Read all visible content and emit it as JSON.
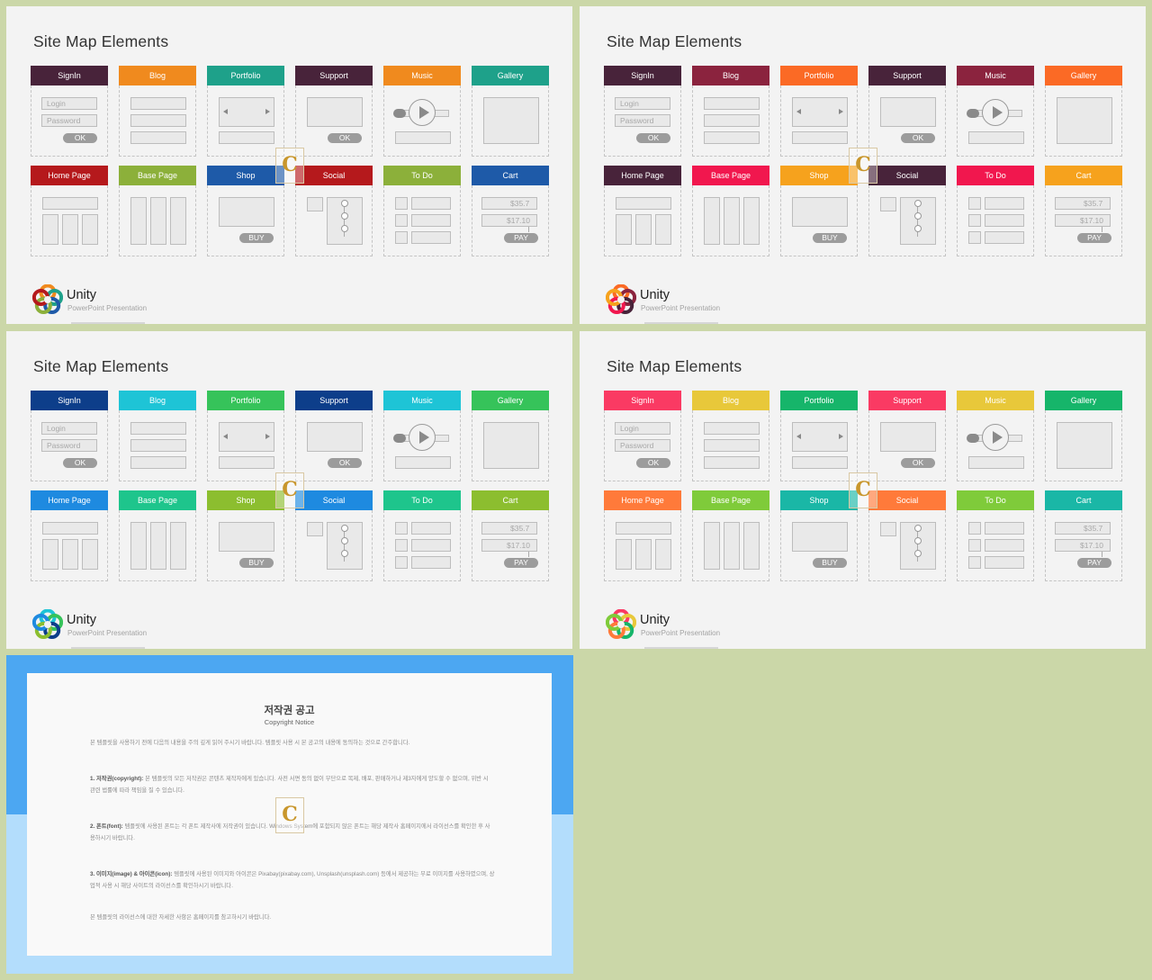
{
  "slides": [
    {
      "title": "Site Map Elements",
      "logo_title": "Unity",
      "logo_sub": "PowerPoint Presentation",
      "logo_colors": [
        "#f08a1e",
        "#1ea18a",
        "#1e5aa8",
        "#8cb03a",
        "#b5191c"
      ],
      "tiles": [
        {
          "label": "SignIn",
          "color": "#48233a",
          "kind": "signin"
        },
        {
          "label": "Blog",
          "color": "#f08a1e",
          "kind": "blog"
        },
        {
          "label": "Portfolio",
          "color": "#1ea18a",
          "kind": "portfolio"
        },
        {
          "label": "Support",
          "color": "#48233a",
          "kind": "support"
        },
        {
          "label": "Music",
          "color": "#f08a1e",
          "kind": "music"
        },
        {
          "label": "Gallery",
          "color": "#1ea18a",
          "kind": "gallery"
        },
        {
          "label": "Home Page",
          "color": "#b5191c",
          "kind": "home"
        },
        {
          "label": "Base Page",
          "color": "#8cb03a",
          "kind": "base"
        },
        {
          "label": "Shop",
          "color": "#1e5aa8",
          "kind": "shop"
        },
        {
          "label": "Social",
          "color": "#b5191c",
          "kind": "social"
        },
        {
          "label": "To Do",
          "color": "#8cb03a",
          "kind": "todo"
        },
        {
          "label": "Cart",
          "color": "#1e5aa8",
          "kind": "cart"
        }
      ]
    },
    {
      "title": "Site Map Elements",
      "logo_title": "Unity",
      "logo_sub": "PowerPoint Presentation",
      "logo_colors": [
        "#fb6a25",
        "#8b233e",
        "#48233a",
        "#f1174e",
        "#f6a21d"
      ],
      "tiles": [
        {
          "label": "SignIn",
          "color": "#48233a",
          "kind": "signin"
        },
        {
          "label": "Blog",
          "color": "#8b233e",
          "kind": "blog"
        },
        {
          "label": "Portfolio",
          "color": "#fb6a25",
          "kind": "portfolio"
        },
        {
          "label": "Support",
          "color": "#48233a",
          "kind": "support"
        },
        {
          "label": "Music",
          "color": "#8b233e",
          "kind": "music"
        },
        {
          "label": "Gallery",
          "color": "#fb6a25",
          "kind": "gallery"
        },
        {
          "label": "Home Page",
          "color": "#48233a",
          "kind": "home"
        },
        {
          "label": "Base Page",
          "color": "#f1174e",
          "kind": "base"
        },
        {
          "label": "Shop",
          "color": "#f6a21d",
          "kind": "shop"
        },
        {
          "label": "Social",
          "color": "#48233a",
          "kind": "social"
        },
        {
          "label": "To Do",
          "color": "#f1174e",
          "kind": "todo"
        },
        {
          "label": "Cart",
          "color": "#f6a21d",
          "kind": "cart"
        }
      ]
    },
    {
      "title": "Site Map Elements",
      "logo_title": "Unity",
      "logo_sub": "PowerPoint Presentation",
      "logo_colors": [
        "#1ec4d6",
        "#36c35a",
        "#0d3e8a",
        "#8cbe2f",
        "#1e8ae0"
      ],
      "tiles": [
        {
          "label": "SignIn",
          "color": "#0d3e8a",
          "kind": "signin"
        },
        {
          "label": "Blog",
          "color": "#1ec4d6",
          "kind": "blog"
        },
        {
          "label": "Portfolio",
          "color": "#36c35a",
          "kind": "portfolio"
        },
        {
          "label": "Support",
          "color": "#0d3e8a",
          "kind": "support"
        },
        {
          "label": "Music",
          "color": "#1ec4d6",
          "kind": "music"
        },
        {
          "label": "Gallery",
          "color": "#36c35a",
          "kind": "gallery"
        },
        {
          "label": "Home Page",
          "color": "#1e8ae0",
          "kind": "home"
        },
        {
          "label": "Base Page",
          "color": "#1ec58c",
          "kind": "base"
        },
        {
          "label": "Shop",
          "color": "#8cbe2f",
          "kind": "shop"
        },
        {
          "label": "Social",
          "color": "#1e8ae0",
          "kind": "social"
        },
        {
          "label": "To Do",
          "color": "#1ec58c",
          "kind": "todo"
        },
        {
          "label": "Cart",
          "color": "#8cbe2f",
          "kind": "cart"
        }
      ]
    },
    {
      "title": "Site Map Elements",
      "logo_title": "Unity",
      "logo_sub": "PowerPoint Presentation",
      "logo_colors": [
        "#fa3a63",
        "#e8c83a",
        "#16b56a",
        "#ff7a3a",
        "#7fcb3a"
      ],
      "tiles": [
        {
          "label": "SignIn",
          "color": "#fa3a63",
          "kind": "signin"
        },
        {
          "label": "Blog",
          "color": "#e8c83a",
          "kind": "blog"
        },
        {
          "label": "Portfolio",
          "color": "#16b56a",
          "kind": "portfolio"
        },
        {
          "label": "Support",
          "color": "#fa3a63",
          "kind": "support"
        },
        {
          "label": "Music",
          "color": "#e8c83a",
          "kind": "music"
        },
        {
          "label": "Gallery",
          "color": "#16b56a",
          "kind": "gallery"
        },
        {
          "label": "Home Page",
          "color": "#ff7a3a",
          "kind": "home"
        },
        {
          "label": "Base Page",
          "color": "#7fcb3a",
          "kind": "base"
        },
        {
          "label": "Shop",
          "color": "#1ab7a6",
          "kind": "shop"
        },
        {
          "label": "Social",
          "color": "#ff7a3a",
          "kind": "social"
        },
        {
          "label": "To Do",
          "color": "#7fcb3a",
          "kind": "todo"
        },
        {
          "label": "Cart",
          "color": "#1ab7a6",
          "kind": "cart"
        }
      ]
    }
  ],
  "placeholders": {
    "login": "Login",
    "password": "Password",
    "ok": "OK",
    "buy": "BUY",
    "pay": "PAY",
    "price1": "$35.7",
    "price2": "$17.10"
  },
  "copyright": {
    "title": "저작권 공고",
    "subtitle": "Copyright Notice",
    "paragraphs": [
      {
        "bold": "",
        "text": "본 템플릿을 사용하기 전에 다음의 내용을 주의 깊게 읽어 주시기 바랍니다. 템플릿 사용 시 본 공고의 내용에 동의하는 것으로 간주합니다."
      },
      {
        "bold": "1. 저작권(copyright):",
        "text": "본 템플릿의 모든 저작권은 콘텐츠 제작자에게 있습니다. 사전 서면 동의 없이 무단으로 복제, 배포, 판매하거나 제3자에게 양도할 수 없으며, 위반 시 관련 법률에 따라 책임을 질 수 있습니다."
      },
      {
        "bold": "2. 폰트(font):",
        "text": "템플릿에 사용된 폰트는 각 폰트 제작사에 저작권이 있습니다. Windows System에 포함되지 않은 폰트는 해당 제작사 홈페이지에서 라이선스를 확인한 후 사용하시기 바랍니다."
      },
      {
        "bold": "3. 이미지(image) & 아이콘(icon):",
        "text": "템플릿에 사용된 이미지와 아이콘은 Pixabay(pixabay.com), Unsplash(unsplash.com) 등에서 제공하는 무료 이미지를 사용하였으며, 상업적 사용 시 해당 사이트의 라이선스를 확인하시기 바랍니다."
      },
      {
        "bold": "",
        "text": "본 템플릿의 라이선스에 대한 자세한 사항은 홈페이지를 참고하시기 바랍니다."
      }
    ]
  },
  "watermark": "C"
}
